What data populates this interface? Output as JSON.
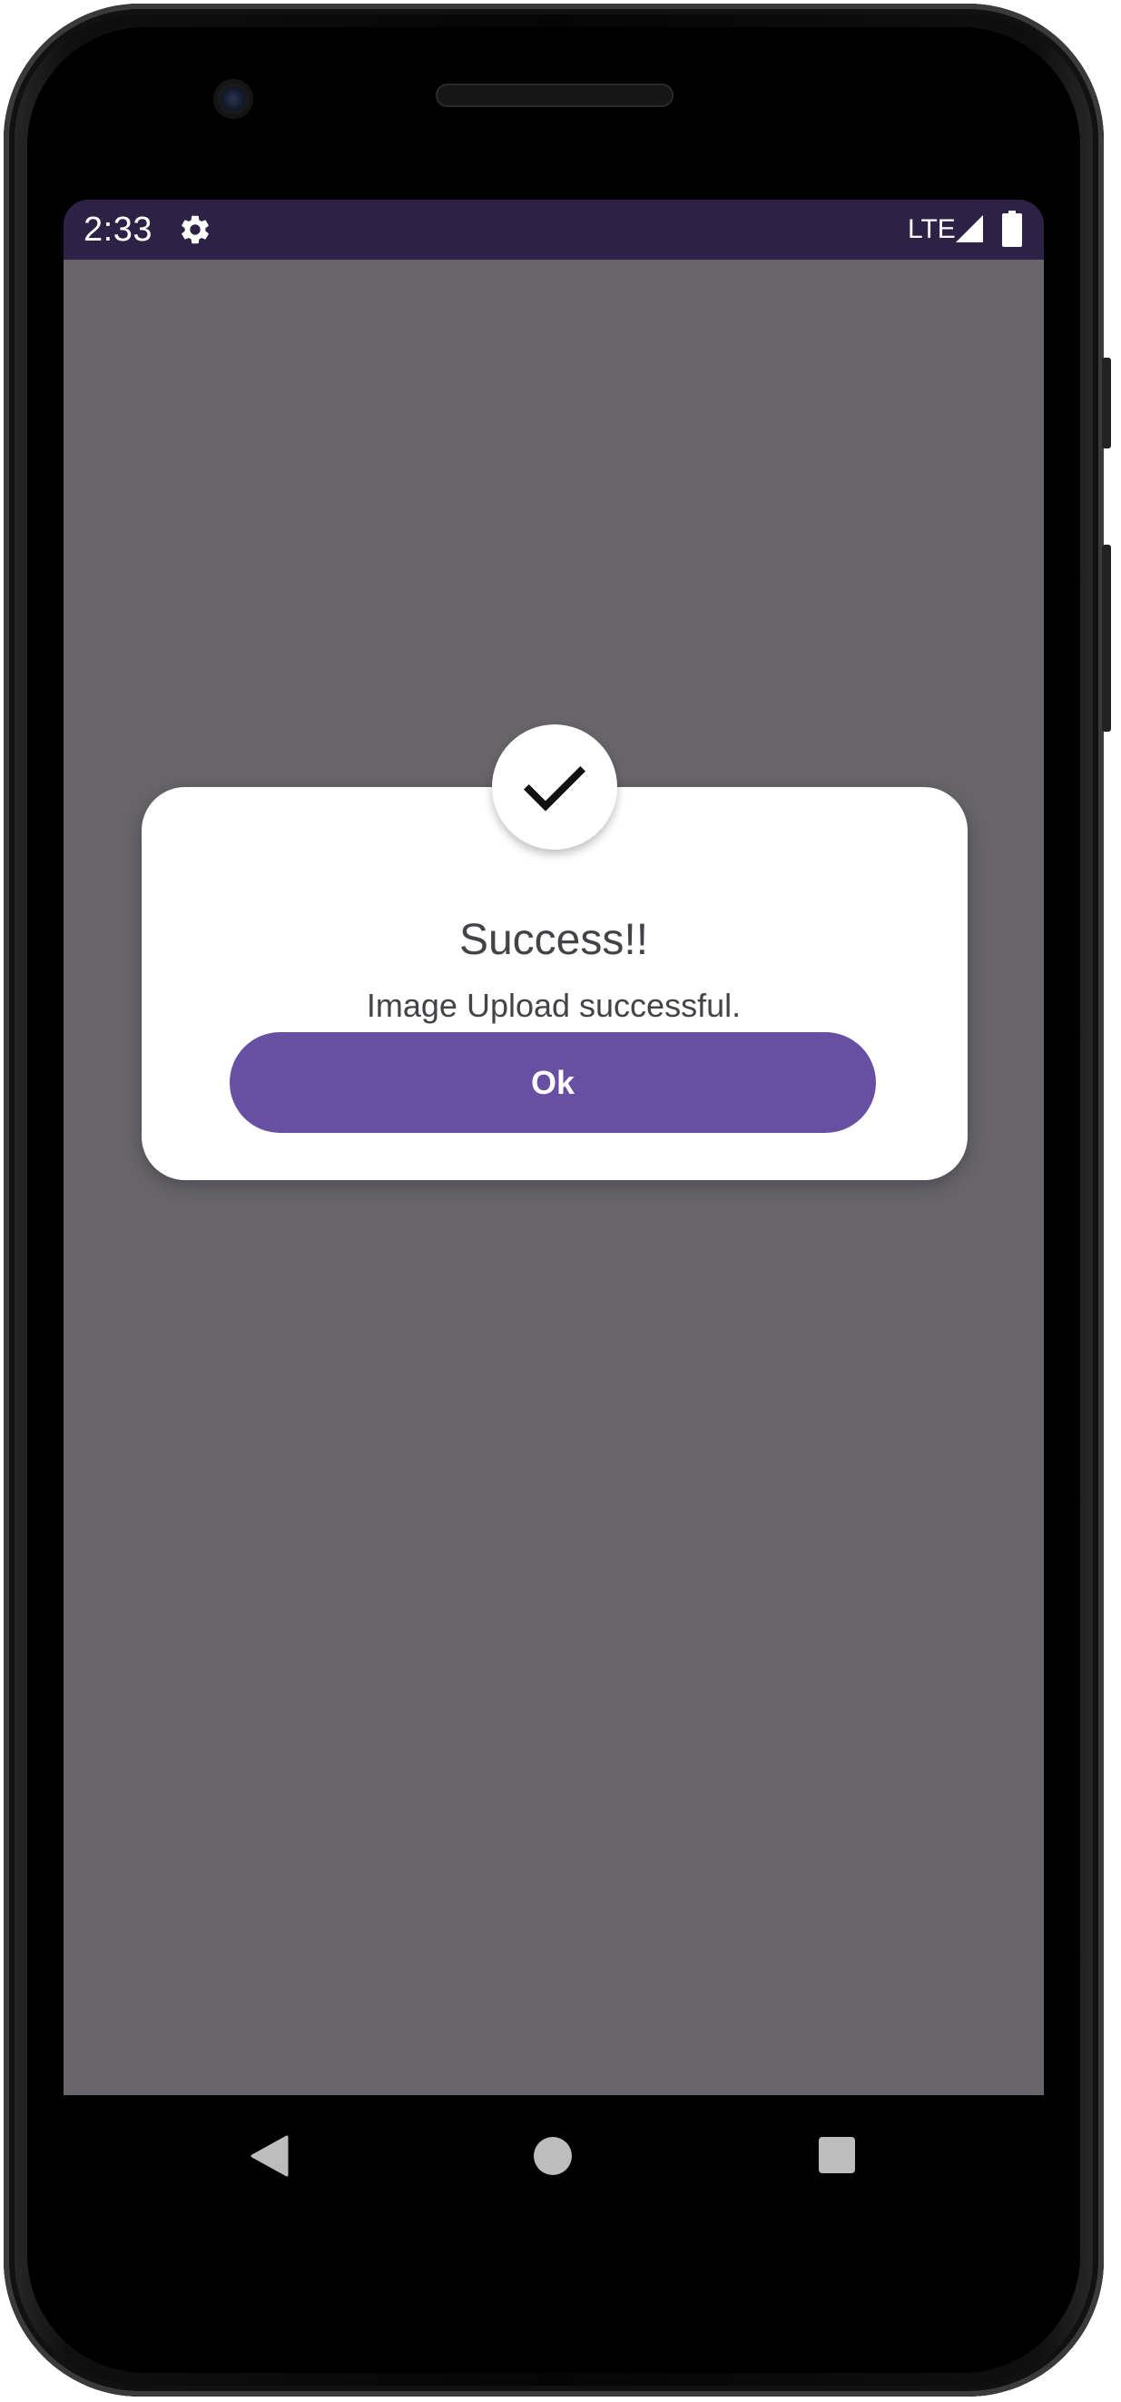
{
  "status_bar": {
    "time": "2:33",
    "settings_icon": "gear-icon",
    "network": "LTE",
    "signal_icon": "signal-icon",
    "battery_icon": "battery-icon",
    "background_color": "#2d2145"
  },
  "screen": {
    "scrim_color": "#67656a"
  },
  "dialog": {
    "icon": "check-icon",
    "title": "Success!!",
    "message": "Image Upload successful.",
    "ok_label": "Ok",
    "button_color": "#6750a4"
  },
  "nav_bar": {
    "back_icon": "back-triangle-icon",
    "home_icon": "home-circle-icon",
    "recents_icon": "recents-square-icon"
  }
}
